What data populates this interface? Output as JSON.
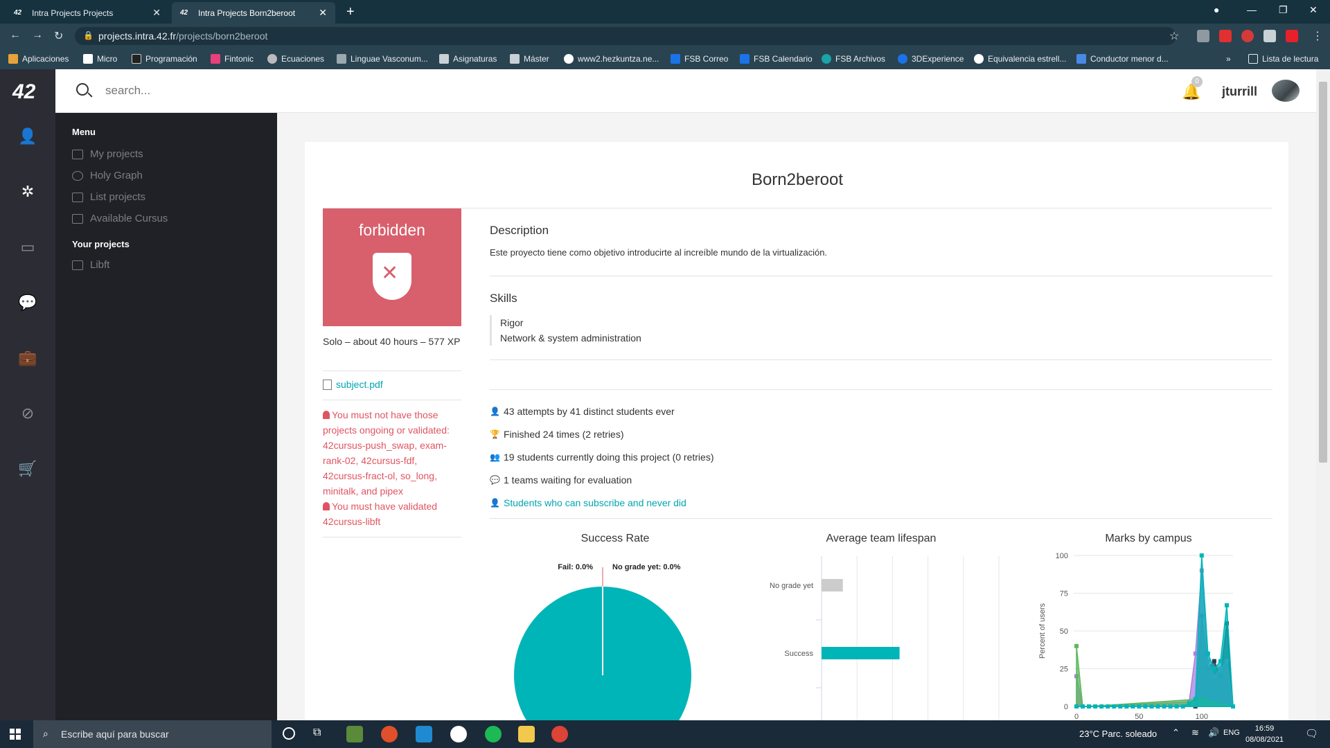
{
  "browser": {
    "tabs": [
      {
        "label": "Intra Projects Projects",
        "active": false
      },
      {
        "label": "Intra Projects Born2beroot",
        "active": true
      }
    ],
    "url_host": "projects.intra.42.fr",
    "url_path": "/projects/born2beroot",
    "bookmarks": [
      "Aplicaciones",
      "Micro",
      "Programación",
      "Fintonic",
      "Ecuaciones",
      "Linguae Vasconum...",
      "Asignaturas",
      "Máster",
      "www2.hezkuntza.ne...",
      "FSB Correo",
      "FSB Calendario",
      "FSB Archivos",
      "3DExperience",
      "Equivalencia estrell...",
      "Conductor menor d..."
    ],
    "bookmarks_more": "»",
    "reading_list": "Lista de lectura"
  },
  "app": {
    "logo": "42",
    "search_placeholder": "search...",
    "notifications_count": "0",
    "username": "jturrill",
    "menu": {
      "heading": "Menu",
      "items": [
        "My projects",
        "Holy Graph",
        "List projects",
        "Available Cursus"
      ],
      "your_projects_heading": "Your projects",
      "your_projects": [
        "Libft"
      ]
    }
  },
  "project": {
    "title": "Born2beroot",
    "thumbnail_label": "forbidden",
    "meta": "Solo – about 40 hours – 577 XP",
    "subject_link": "subject.pdf",
    "requirement_1": "You must not have those projects ongoing or validated: 42cursus-push_swap, exam-rank-02, 42cursus-fdf, 42cursus-fract-ol, so_long, minitalk, and pipex",
    "requirement_2": "You must have validated 42cursus-libft",
    "description_heading": "Description",
    "description": "Este proyecto tiene como objetivo introducirte al increíble mundo de la virtualización.",
    "skills_heading": "Skills",
    "skills": [
      "Rigor",
      "Network & system administration"
    ],
    "stats": [
      "43 attempts by 41 distinct students ever",
      "Finished 24 times (2 retries)",
      "19 students currently doing this project (0 retries)",
      "1 teams waiting for evaluation",
      "Students who can subscribe and never did"
    ]
  },
  "chart_data": [
    {
      "type": "pie",
      "title": "Success Rate",
      "labels": [
        "Fail: 0.0%",
        "No grade yet: 0.0%"
      ],
      "slices": [
        {
          "name": "Success",
          "value": 100.0,
          "color": "#00b5b8"
        },
        {
          "name": "Fail",
          "value": 0.0,
          "color": "#e05461"
        },
        {
          "name": "No grade yet",
          "value": 0.0,
          "color": "#cccccc"
        }
      ]
    },
    {
      "type": "bar",
      "title": "Average team lifespan",
      "categories": [
        "No grade yet",
        "Success"
      ],
      "values": [
        0.6,
        2.2
      ],
      "xlim": [
        0,
        5
      ],
      "colors": [
        "#cccccc",
        "#00b5b8"
      ]
    },
    {
      "type": "area",
      "title": "Marks by campus",
      "ylabel": "Percent of users",
      "xticks": [
        "0",
        "50",
        "100"
      ],
      "yticks": [
        "100",
        "75",
        "50",
        "25",
        "0"
      ],
      "ylim": [
        0,
        100
      ],
      "xlim": [
        0,
        125
      ],
      "series": [
        {
          "color": "#00b5b8",
          "x": [
            0,
            5,
            10,
            15,
            20,
            25,
            30,
            35,
            40,
            45,
            50,
            55,
            60,
            65,
            70,
            75,
            80,
            85,
            90,
            95,
            100,
            105,
            110,
            115,
            120,
            125
          ],
          "y": [
            0,
            0,
            0,
            0,
            0,
            0,
            0,
            0,
            0,
            0,
            0,
            0,
            0,
            0,
            0,
            0,
            0,
            0,
            2,
            5,
            100,
            35,
            25,
            30,
            67,
            0
          ]
        },
        {
          "color": "#5cb85c",
          "x": [
            0,
            5,
            10,
            100,
            125
          ],
          "y": [
            40,
            0,
            0,
            5,
            0
          ]
        },
        {
          "color": "#a880e0",
          "x": [
            0,
            5,
            90,
            95,
            100,
            105,
            110,
            115,
            120,
            125
          ],
          "y": [
            20,
            0,
            3,
            35,
            90,
            30,
            20,
            25,
            30,
            0
          ]
        },
        {
          "color": "#2c3e55",
          "x": [
            0,
            95,
            100,
            105,
            110,
            115,
            120,
            125
          ],
          "y": [
            0,
            0,
            60,
            25,
            30,
            20,
            55,
            0
          ]
        }
      ]
    }
  ],
  "taskbar": {
    "search_placeholder": "Escribe aquí para buscar",
    "weather": "23°C  Parc. soleado",
    "lang": "ENG",
    "time": "16:59",
    "date": "08/08/2021"
  }
}
